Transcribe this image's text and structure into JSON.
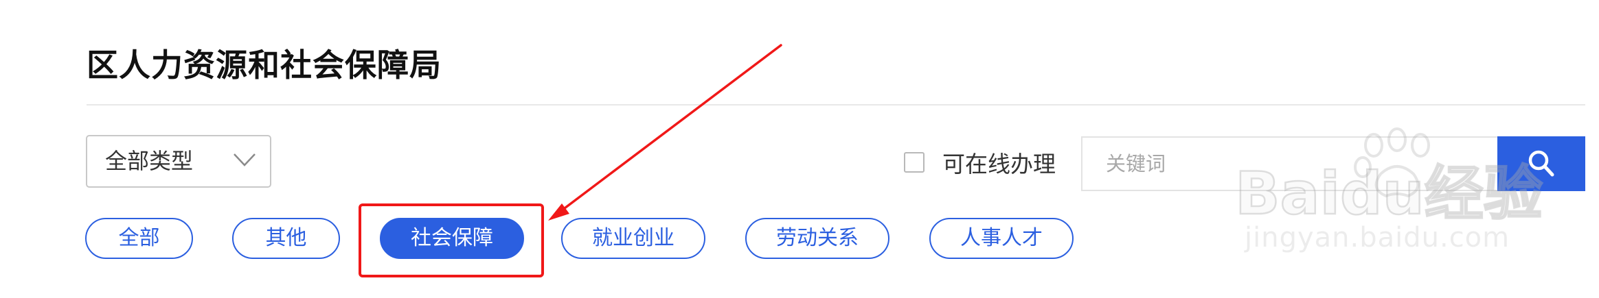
{
  "page": {
    "title": "区人力资源和社会保障局"
  },
  "filters": {
    "type_select": {
      "selected": "全部类型"
    },
    "online_checkbox": {
      "label": "可在线办理",
      "checked": false
    },
    "search": {
      "placeholder": "关键词",
      "value": ""
    }
  },
  "categories": [
    {
      "label": "全部",
      "active": false
    },
    {
      "label": "其他",
      "active": false
    },
    {
      "label": "社会保障",
      "active": true
    },
    {
      "label": "就业创业",
      "active": false
    },
    {
      "label": "劳动关系",
      "active": false
    },
    {
      "label": "人事人才",
      "active": false
    }
  ],
  "watermark": {
    "logo_text": "Baidu经验",
    "url": "jingyan.baidu.com"
  },
  "icons": {
    "select": "chevron-down-icon",
    "search": "search-icon"
  },
  "colors": {
    "accent": "#2b5fe0",
    "annotation": "#f01818"
  }
}
